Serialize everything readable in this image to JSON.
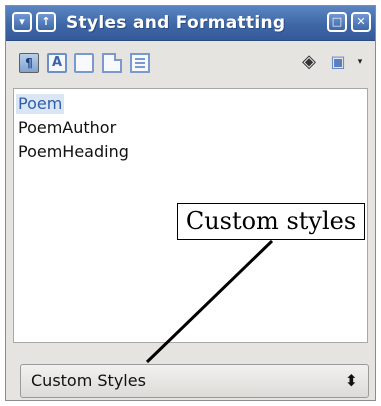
{
  "window": {
    "title": "Styles and Formatting",
    "titlebar_buttons": [
      "chevron-down-icon",
      "arrow-up-icon",
      "maximize-icon",
      "close-icon"
    ]
  },
  "toolbar": {
    "style_categories": [
      {
        "name": "Paragraph Styles",
        "icon": "paragraph-styles-icon",
        "glyph": "¶",
        "active": true
      },
      {
        "name": "Character Styles",
        "icon": "character-styles-icon",
        "glyph": "A"
      },
      {
        "name": "Frame Styles",
        "icon": "frame-styles-icon"
      },
      {
        "name": "Page Styles",
        "icon": "page-styles-icon"
      },
      {
        "name": "List Styles",
        "icon": "list-styles-icon"
      }
    ],
    "fill_format_icon": "paint-bucket-icon",
    "new_style_icon": "new-style-icon",
    "dropdown_glyph": "▾"
  },
  "styles": [
    "Poem",
    "PoemAuthor",
    "PoemHeading"
  ],
  "selected_style": "Poem",
  "annotation": {
    "text": "Custom styles"
  },
  "filter": {
    "value": "Custom Styles",
    "arrows": "⬍"
  },
  "colors": {
    "titlebar": "#3e67a6",
    "selection_text": "#2f5ea8"
  }
}
